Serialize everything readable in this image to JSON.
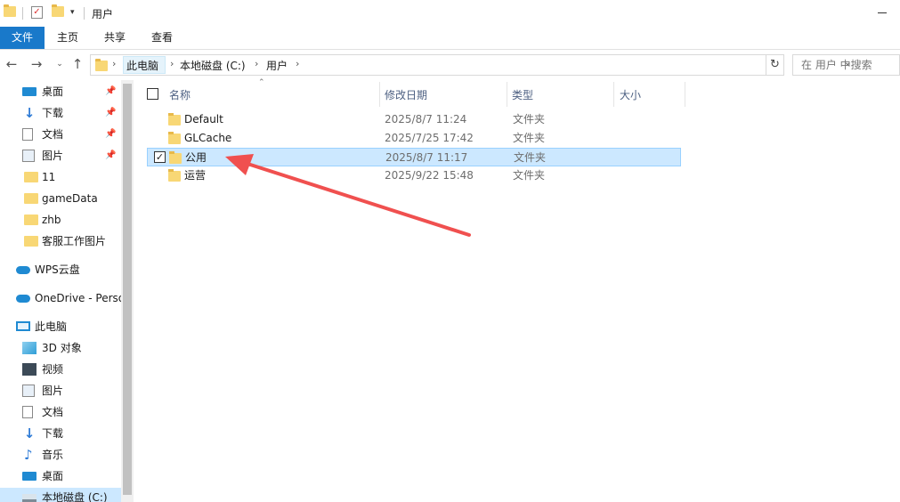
{
  "window": {
    "title": "用户"
  },
  "ribbon": {
    "tabs": [
      "文件",
      "主页",
      "共享",
      "查看"
    ]
  },
  "address": {
    "crumbs": [
      "此电脑",
      "本地磁盘 (C:)",
      "用户"
    ],
    "search_placeholder": "在 用户 中搜索"
  },
  "sidebar": {
    "items": [
      {
        "label": "桌面",
        "icon": "desktop-icon",
        "pinned": true
      },
      {
        "label": "下载",
        "icon": "download-icon",
        "pinned": true
      },
      {
        "label": "文档",
        "icon": "document-icon",
        "pinned": true
      },
      {
        "label": "图片",
        "icon": "picture-icon",
        "pinned": true
      },
      {
        "label": "11",
        "icon": "folder-icon",
        "pinned": false
      },
      {
        "label": "gameData",
        "icon": "folder-icon",
        "pinned": false
      },
      {
        "label": "zhb",
        "icon": "folder-icon",
        "pinned": false
      },
      {
        "label": "客服工作图片",
        "icon": "folder-icon",
        "pinned": false
      },
      {
        "label": "WPS云盘",
        "icon": "cloud-icon",
        "pinned": false
      },
      {
        "label": "OneDrive - Perso",
        "icon": "onedrive-icon",
        "pinned": false
      },
      {
        "label": "此电脑",
        "icon": "pc-icon",
        "pinned": false
      },
      {
        "label": "3D 对象",
        "icon": "3d-objects-icon",
        "pinned": false
      },
      {
        "label": "视频",
        "icon": "video-icon",
        "pinned": false
      },
      {
        "label": "图片",
        "icon": "picture-icon",
        "pinned": false
      },
      {
        "label": "文档",
        "icon": "document-icon",
        "pinned": false
      },
      {
        "label": "下载",
        "icon": "download-icon",
        "pinned": false
      },
      {
        "label": "音乐",
        "icon": "music-icon",
        "pinned": false
      },
      {
        "label": "桌面",
        "icon": "desktop-icon",
        "pinned": false
      },
      {
        "label": "本地磁盘 (C:)",
        "icon": "drive-icon",
        "pinned": false
      }
    ]
  },
  "columns": {
    "name": "名称",
    "date": "修改日期",
    "type": "类型",
    "size": "大小"
  },
  "files": [
    {
      "name": "Default",
      "date": "2025/8/7 11:24",
      "type": "文件夹",
      "selected": false
    },
    {
      "name": "GLCache",
      "date": "2025/7/25 17:42",
      "type": "文件夹",
      "selected": false
    },
    {
      "name": "公用",
      "date": "2025/8/7 11:17",
      "type": "文件夹",
      "selected": true
    },
    {
      "name": "运营",
      "date": "2025/9/22 15:48",
      "type": "文件夹",
      "selected": false
    }
  ],
  "colors": {
    "accent": "#1979ca",
    "selection": "#cce8ff",
    "annotation_arrow": "#f0504f"
  }
}
